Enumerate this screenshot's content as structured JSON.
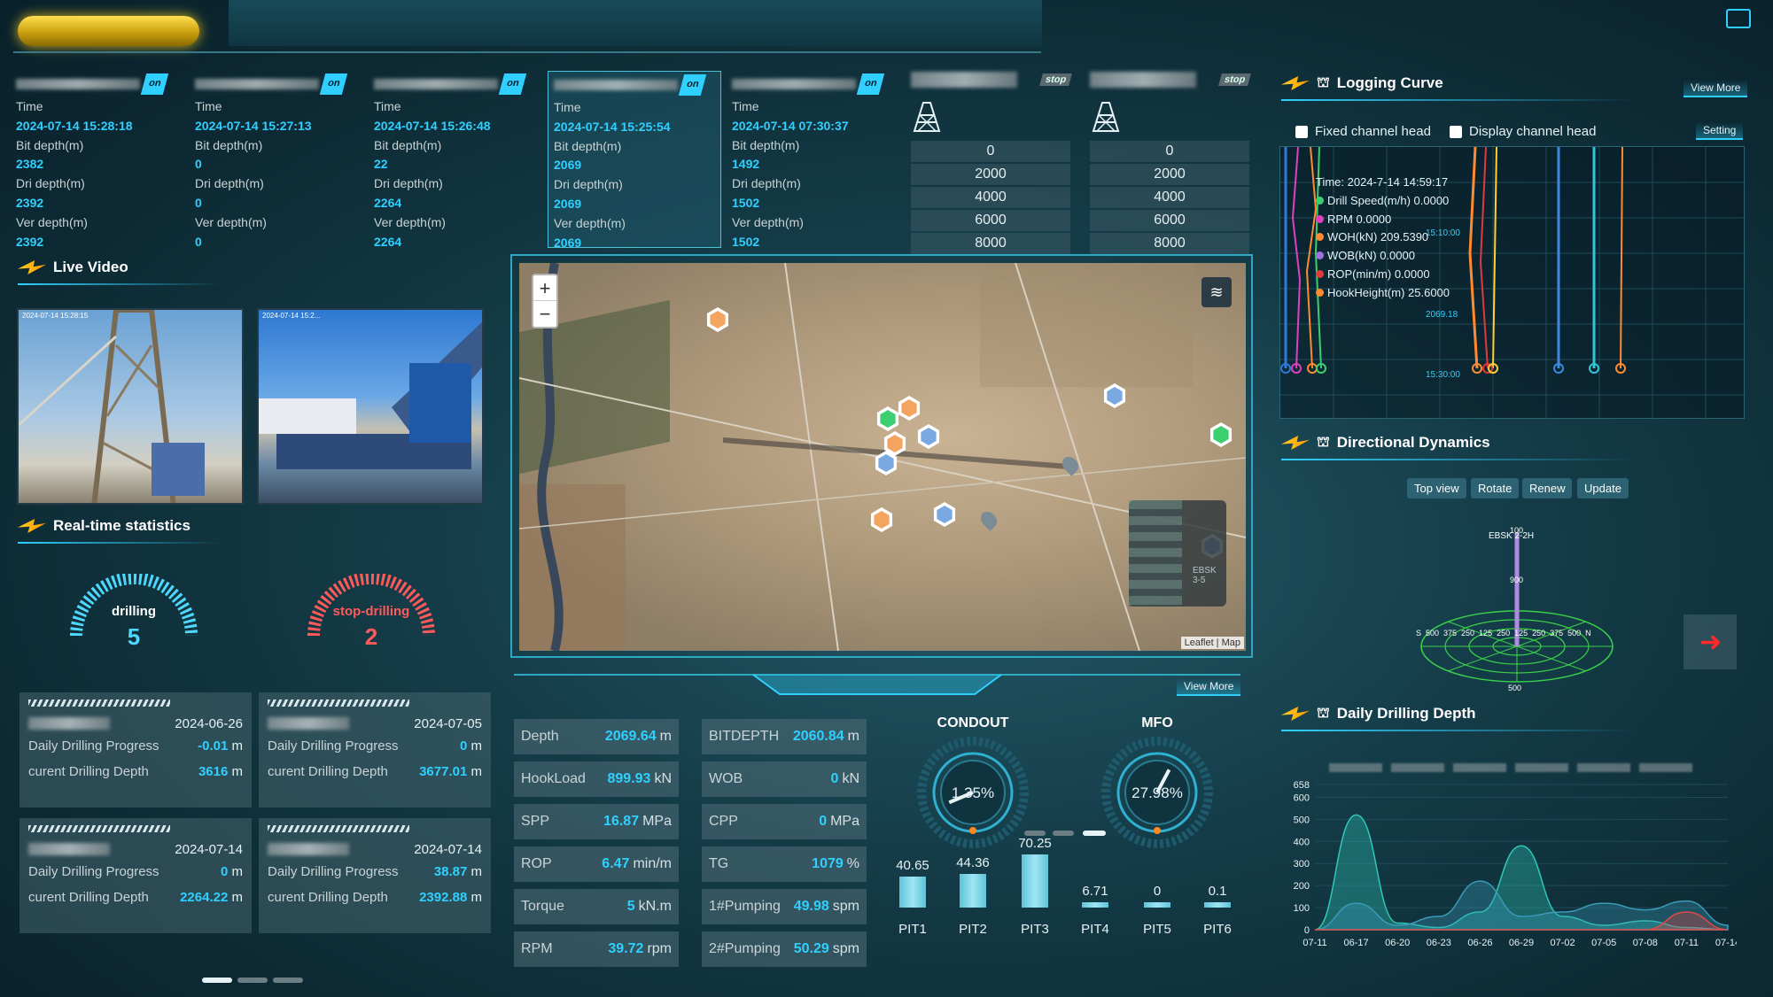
{
  "wells": [
    {
      "status": "on",
      "time_label": "Time",
      "time": "2024-07-14 15:28:18",
      "bit_label": "Bit depth(m)",
      "bit": "2382",
      "dri_label": "Dri depth(m)",
      "dri": "2392",
      "ver_label": "Ver depth(m)",
      "ver": "2392"
    },
    {
      "status": "on",
      "time_label": "Time",
      "time": "2024-07-14 15:27:13",
      "bit_label": "Bit depth(m)",
      "bit": "0",
      "dri_label": "Dri depth(m)",
      "dri": "0",
      "ver_label": "Ver depth(m)",
      "ver": "0"
    },
    {
      "status": "on",
      "time_label": "Time",
      "time": "2024-07-14 15:26:48",
      "bit_label": "Bit depth(m)",
      "bit": "22",
      "dri_label": "Dri depth(m)",
      "dri": "2264",
      "ver_label": "Ver depth(m)",
      "ver": "2264"
    },
    {
      "status": "on",
      "time_label": "Time",
      "time": "2024-07-14 15:25:54",
      "bit_label": "Bit depth(m)",
      "bit": "2069",
      "dri_label": "Dri depth(m)",
      "dri": "2069",
      "ver_label": "Ver depth(m)",
      "ver": "2069"
    },
    {
      "status": "on",
      "time_label": "Time",
      "time": "2024-07-14 07:30:37",
      "bit_label": "Bit depth(m)",
      "bit": "1492",
      "dri_label": "Dri depth(m)",
      "dri": "1502",
      "ver_label": "Ver depth(m)",
      "ver": "1502"
    }
  ],
  "stopped_rigs": [
    {
      "status": "stop",
      "depths": [
        "0",
        "2000",
        "4000",
        "6000",
        "8000"
      ]
    },
    {
      "status": "stop",
      "depths": [
        "0",
        "2000",
        "4000",
        "6000",
        "8000"
      ]
    }
  ],
  "live_video": {
    "title": "Live Video",
    "cams": [
      {
        "stamp": "2024-07-14 15:28:15"
      },
      {
        "stamp": "2024-07-14 15:2..."
      }
    ]
  },
  "realtime": {
    "title": "Real-time statistics",
    "drilling_label": "drilling",
    "drilling_count": "5",
    "stop_label": "stop-drilling",
    "stop_count": "2",
    "cards": [
      {
        "date": "2024-06-26",
        "progress_label": "Daily Drilling Progress",
        "progress": "-0.01",
        "progress_unit": "m",
        "depth_label": "curent Drilling Depth",
        "depth": "3616",
        "depth_unit": "m"
      },
      {
        "date": "2024-07-05",
        "progress_label": "Daily Drilling Progress",
        "progress": "0",
        "progress_unit": "m",
        "depth_label": "curent Drilling Depth",
        "depth": "3677.01",
        "depth_unit": "m"
      },
      {
        "date": "2024-07-14",
        "progress_label": "Daily Drilling Progress",
        "progress": "0",
        "progress_unit": "m",
        "depth_label": "curent Drilling Depth",
        "depth": "2264.22",
        "depth_unit": "m"
      },
      {
        "date": "2024-07-14",
        "progress_label": "Daily Drilling Progress",
        "progress": "38.87",
        "progress_unit": "m",
        "depth_label": "curent Drilling Depth",
        "depth": "2392.88",
        "depth_unit": "m"
      }
    ]
  },
  "map": {
    "zoom_in": "+",
    "zoom_out": "−",
    "layers_icon": "layers-icon",
    "attribution": "Leaflet | Map",
    "overview_label": "EBSK 3-5"
  },
  "params_view_more": "View More",
  "params": [
    {
      "k": "Depth",
      "v": "2069.64",
      "u": "m"
    },
    {
      "k": "BITDEPTH",
      "v": "2060.84",
      "u": "m"
    },
    {
      "k": "HookLoad",
      "v": "899.93",
      "u": "kN"
    },
    {
      "k": "WOB",
      "v": "0",
      "u": "kN"
    },
    {
      "k": "SPP",
      "v": "16.87",
      "u": "MPa"
    },
    {
      "k": "CPP",
      "v": "0",
      "u": "MPa"
    },
    {
      "k": "ROP",
      "v": "6.47",
      "u": "min/m"
    },
    {
      "k": "TG",
      "v": "1079",
      "u": "%"
    },
    {
      "k": "Torque",
      "v": "5",
      "u": "kN.m"
    },
    {
      "k": "1#Pumping",
      "v": "49.98",
      "u": "spm"
    },
    {
      "k": "RPM",
      "v": "39.72",
      "u": "rpm"
    },
    {
      "k": "2#Pumping",
      "v": "50.29",
      "u": "spm"
    }
  ],
  "dials": [
    {
      "title": "CONDOUT",
      "value": "1.35%",
      "fraction": 0.0135
    },
    {
      "title": "MFO",
      "value": "27.98%",
      "fraction": 0.2798
    }
  ],
  "pits": [
    {
      "name": "PIT1",
      "value": "40.65",
      "level": 40.65
    },
    {
      "name": "PIT2",
      "value": "44.36",
      "level": 44.36
    },
    {
      "name": "PIT3",
      "value": "70.25",
      "level": 70.25
    },
    {
      "name": "PIT4",
      "value": "6.71",
      "level": 6.71
    },
    {
      "name": "PIT5",
      "value": "0",
      "level": 0
    },
    {
      "name": "PIT6",
      "value": "0.1",
      "level": 0.1
    }
  ],
  "logging": {
    "title": "Logging Curve",
    "view_more": "View More",
    "fixed_head": "Fixed channel head",
    "display_head": "Display channel head",
    "setting": "Setting",
    "depth_marks": [
      "15:10:00",
      "2069.18",
      "15:30:00"
    ],
    "tooltip": [
      {
        "text": "Time:    2024-7-14 14:59:17",
        "color": ""
      },
      {
        "text": "Drill Speed(m/h) 0.0000",
        "color": "#3ccf70"
      },
      {
        "text": "RPM 0.0000",
        "color": "#e040c0"
      },
      {
        "text": "WOH(kN) 209.5390",
        "color": "#ff8a30"
      },
      {
        "text": "WOB(kN) 0.0000",
        "color": "#a070e0"
      },
      {
        "text": "ROP(min/m) 0.0000",
        "color": "#e03a3a"
      },
      {
        "text": "HookHeight(m) 25.6000",
        "color": "#ff8a30"
      }
    ]
  },
  "directional": {
    "title": "Directional Dynamics",
    "buttons": [
      "Top view",
      "Rotate",
      "Renew",
      "Update"
    ],
    "well_name": "EBSK 2-2H",
    "axis_top": "100",
    "axis_900": "900",
    "ns_labels": "S  500  375  250  125  250  125  250  375  500  N",
    "ring_labels": [
      "500",
      "375",
      "250",
      "125"
    ],
    "bottom": "500",
    "next_icon": "arrow-right-icon"
  },
  "chart_data": {
    "type": "area",
    "title": "Daily Drilling Depth",
    "x": [
      "07-11",
      "06-17",
      "06-20",
      "06-23",
      "06-26",
      "06-29",
      "07-02",
      "07-05",
      "07-08",
      "07-11",
      "07-14"
    ],
    "yticks": [
      0,
      100,
      200,
      300,
      400,
      500,
      600,
      658
    ],
    "ylim": [
      0,
      658
    ],
    "series": [
      {
        "color": "#2fc8b8",
        "values": [
          0,
          520,
          30,
          10,
          80,
          380,
          60,
          20,
          40,
          10,
          0
        ]
      },
      {
        "color": "#3a9ab8",
        "values": [
          0,
          120,
          20,
          60,
          220,
          60,
          80,
          120,
          90,
          130,
          20
        ]
      },
      {
        "color": "#e04848",
        "values": [
          0,
          0,
          0,
          0,
          0,
          0,
          0,
          0,
          0,
          80,
          0
        ]
      }
    ]
  }
}
